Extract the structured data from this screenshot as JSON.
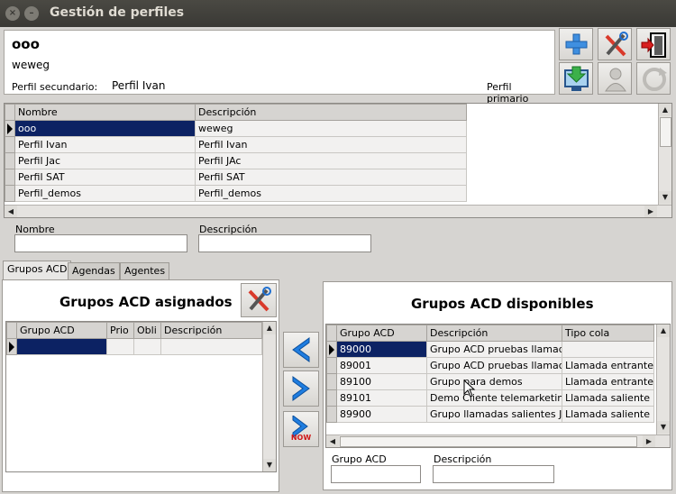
{
  "window": {
    "title": "Gestión de perfiles"
  },
  "header": {
    "profile_name": "ooo",
    "profile_description": "weweg",
    "secondary_label": "Perfil secundario:",
    "secondary_value": "Perfil Ivan",
    "primary_label": "Perfil primario"
  },
  "profiles_grid": {
    "columns": [
      "Nombre",
      "Descripción"
    ],
    "rows": [
      [
        "ooo",
        "weweg"
      ],
      [
        "Perfil Ivan",
        "Perfil Ivan"
      ],
      [
        "Perfil Jac",
        "Perfil JAc"
      ],
      [
        "Perfil SAT",
        "Perfil SAT"
      ],
      [
        "Perfil_demos",
        "Perfil_demos"
      ]
    ]
  },
  "filters": {
    "name_label": "Nombre",
    "desc_label": "Descripción"
  },
  "tabs": [
    "Grupos ACD",
    "Agendas",
    "Agentes"
  ],
  "assigned": {
    "title": "Grupos ACD asignados",
    "columns": [
      "Grupo ACD",
      "Prio",
      "Obli",
      "Descripción"
    ]
  },
  "available": {
    "title": "Grupos ACD disponibles",
    "columns": [
      "Grupo ACD",
      "Descripción",
      "Tipo cola"
    ],
    "rows": [
      [
        "89000",
        "Grupo ACD pruebas llamada",
        ""
      ],
      [
        "89001",
        "Grupo ACD pruebas llamada",
        "Llamada entrante"
      ],
      [
        "89100",
        "Grupo para demos",
        "Llamada entrante"
      ],
      [
        "89101",
        "Demo Cliente telemarketing",
        "Llamada saliente"
      ],
      [
        "89900",
        "Grupo llamadas salientes JA",
        "Llamada saliente"
      ]
    ],
    "filter_group_label": "Grupo ACD",
    "filter_desc_label": "Descripción"
  },
  "move_buttons": {
    "now_label": "NOW"
  },
  "colors": {
    "selection": "#0c2263",
    "titlebar": "#3a3935"
  }
}
